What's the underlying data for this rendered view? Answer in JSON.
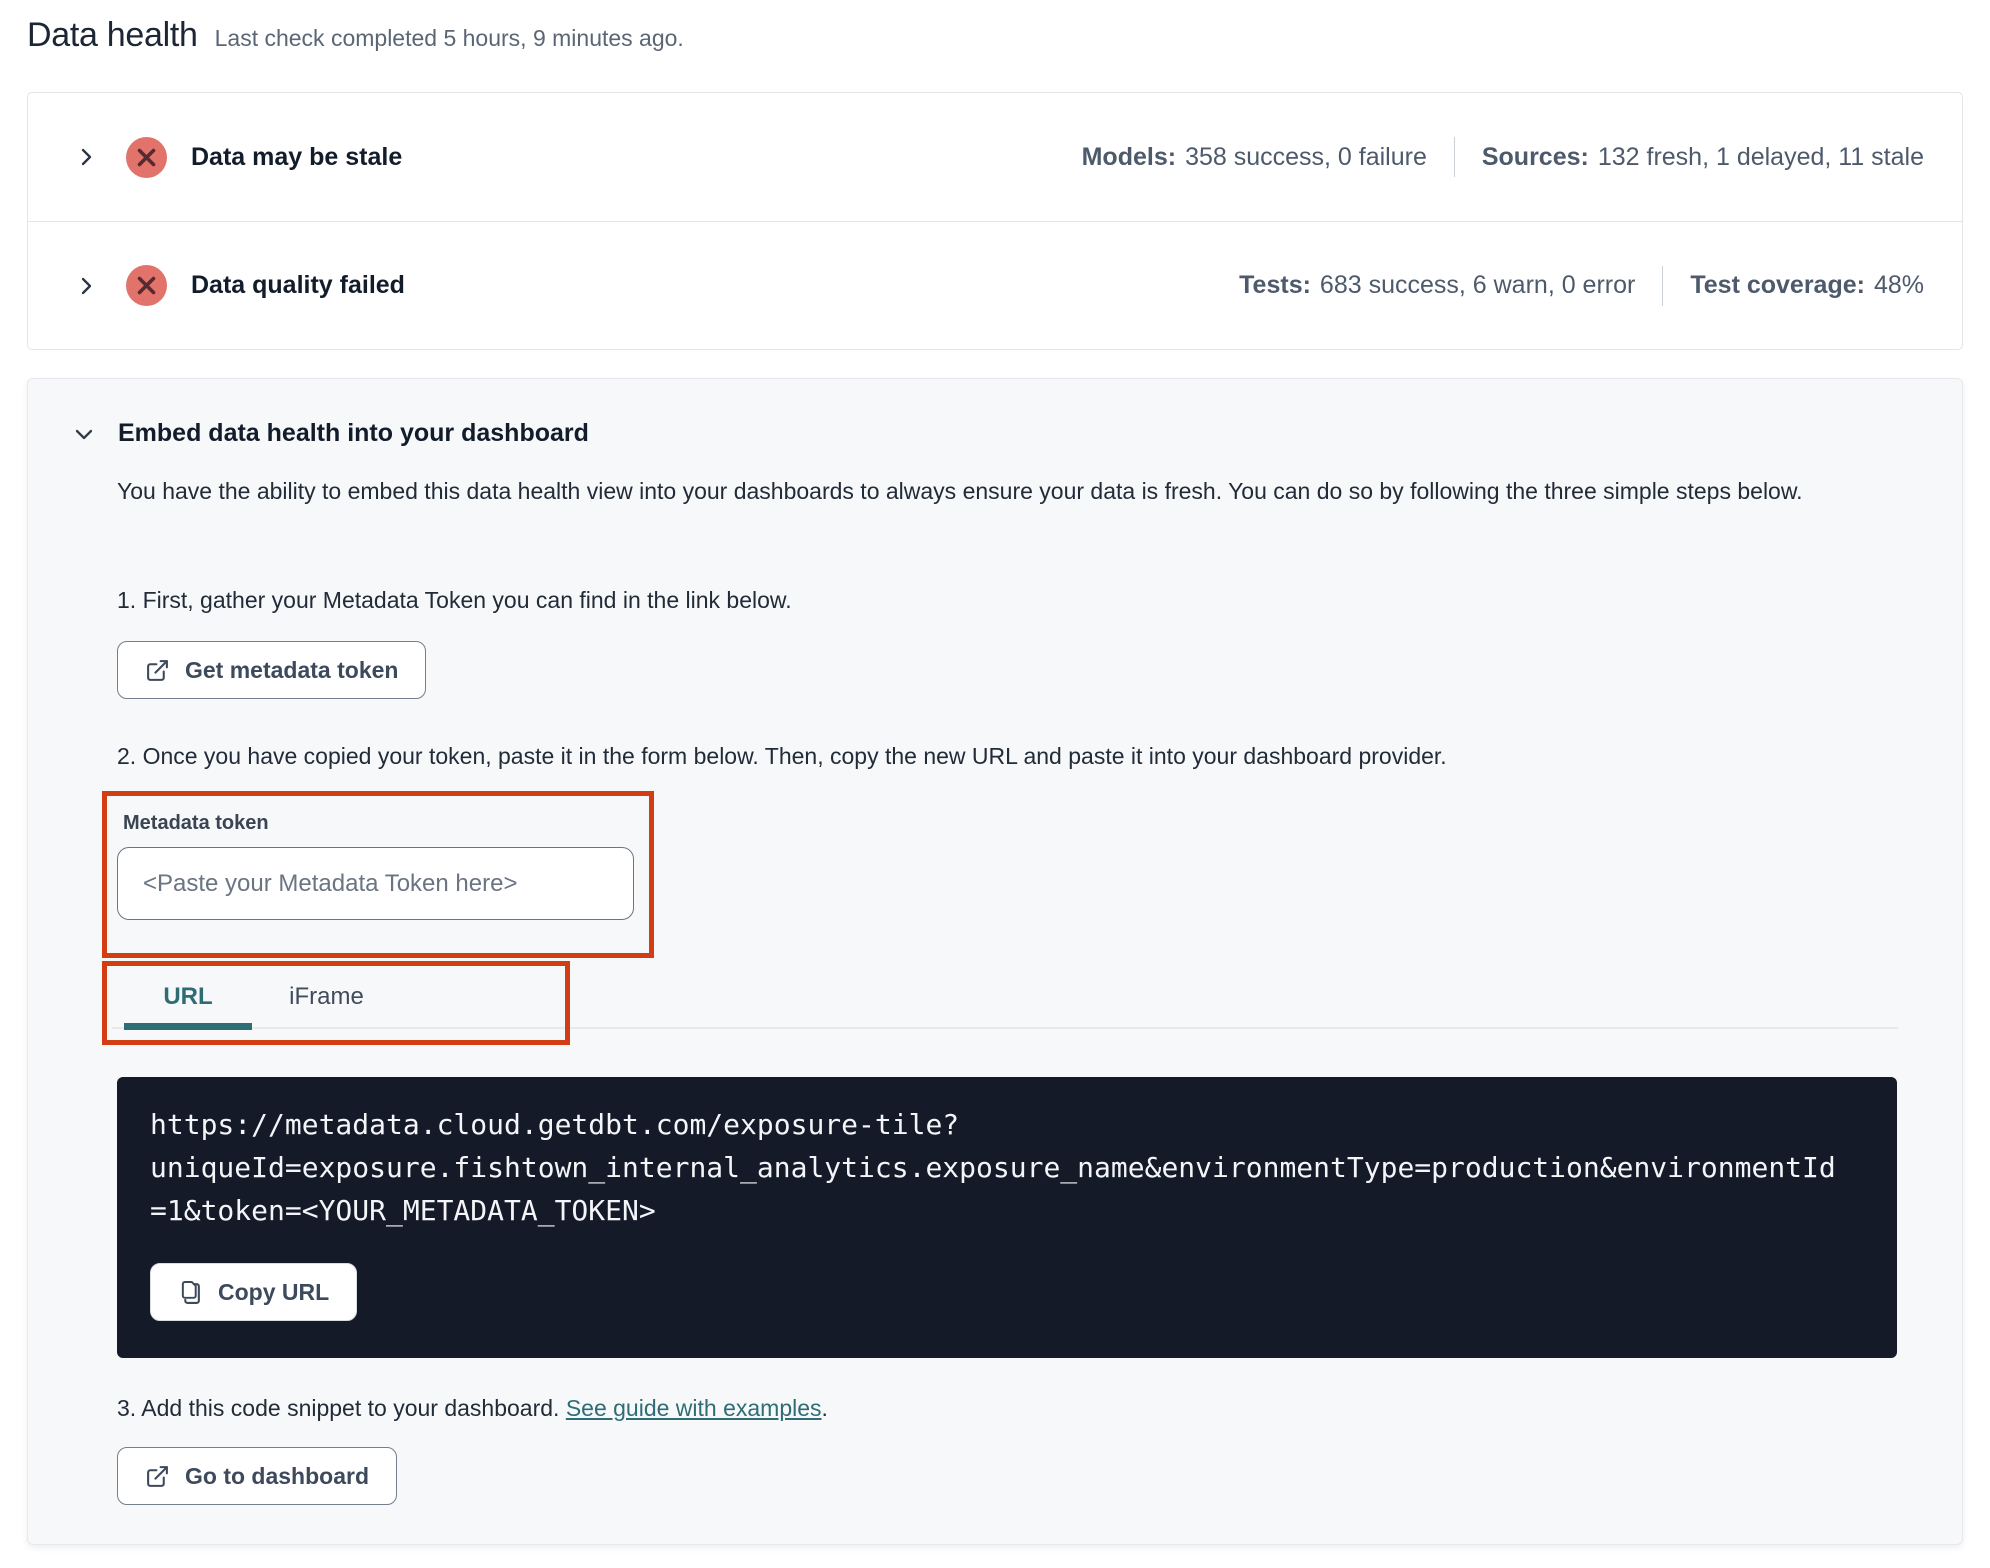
{
  "page": {
    "title": "Data health",
    "subtitle": "Last check completed 5 hours, 9 minutes ago."
  },
  "status_rows": [
    {
      "title": "Data may be stale",
      "state": "collapsed",
      "status": "error",
      "stats": [
        {
          "label": "Models:",
          "value": "358 success, 0 failure"
        },
        {
          "label": "Sources:",
          "value": "132 fresh, 1 delayed, 11 stale"
        }
      ]
    },
    {
      "title": "Data quality failed",
      "state": "collapsed",
      "status": "error",
      "stats": [
        {
          "label": "Tests:",
          "value": "683 success, 6 warn, 0 error"
        },
        {
          "label": "Test coverage:",
          "value": "48%"
        }
      ]
    }
  ],
  "embed": {
    "heading": "Embed data health into your dashboard",
    "state": "expanded",
    "description": "You have the ability to embed this data health view into your dashboards to always ensure your data is fresh. You can do so by following the three simple steps below.",
    "step1": "1. First, gather your Metadata Token you can find in the link below.",
    "get_token_button": "Get metadata token",
    "step2": "2. Once you have copied your token, paste it in the form below. Then, copy the new URL and paste it into your dashboard provider.",
    "token_field": {
      "label": "Metadata token",
      "placeholder": "<Paste your Metadata Token here>",
      "value": ""
    },
    "tabs": [
      {
        "label": "URL",
        "active": true
      },
      {
        "label": "iFrame",
        "active": false
      }
    ],
    "code": {
      "url": "https://metadata.cloud.getdbt.com/exposure-tile?uniqueId=exposure.fishtown_internal_analytics.exposure_name&environmentType=production&environmentId=1&token=<YOUR_METADATA_TOKEN>",
      "lines": [
        "https://metadata.cloud.getdbt.com/exposure-tile?",
        "uniqueId=exposure.fishtown_internal_analytics.exposure_name&environmentType=production&environmentId",
        "=1&token=<YOUR_METADATA_TOKEN>"
      ],
      "copy_button": "Copy URL"
    },
    "step3_prefix": "3. Add this code snippet to your dashboard. ",
    "step3_link": "See guide with examples",
    "step3_suffix": ".",
    "dashboard_button": "Go to dashboard"
  },
  "icons": {
    "chevron_right": "chevron-right-icon",
    "chevron_down": "chevron-down-icon",
    "error_circle_x": "error-x-icon",
    "external_link": "external-link-icon",
    "copy": "copy-icon"
  },
  "colors": {
    "error_icon_bg": "#e2736a",
    "error_icon_x": "#542a33",
    "teal_accent": "#2e6d74",
    "annotation_red": "#d23d14",
    "code_block_bg": "#151a29",
    "panel_bg": "#f7f8fa",
    "stat_text": "#4d5a6c"
  }
}
